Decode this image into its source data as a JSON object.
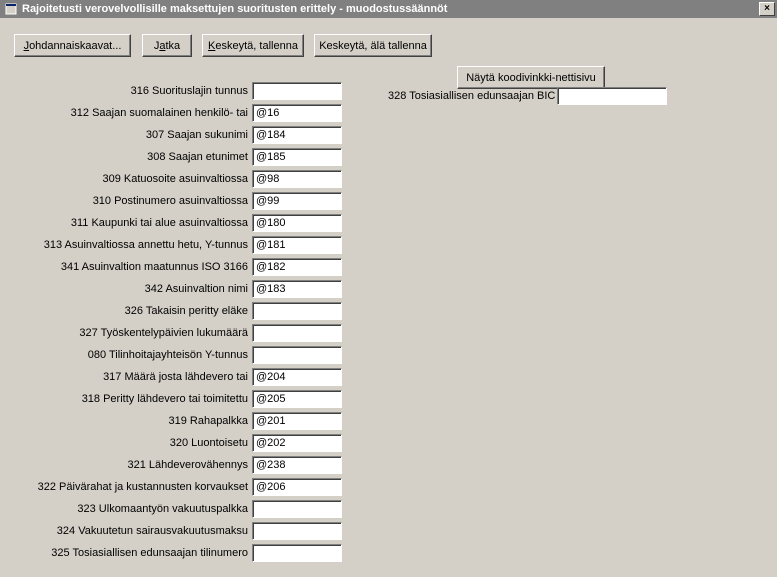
{
  "window": {
    "title": "Rajoitetusti verovelvollisille maksettujen suoritusten erittely - muodostussäännöt",
    "close": "×"
  },
  "toolbar": {
    "johdannaiskaavat": "Johdannaiskaavat...",
    "jatka_pre": "J",
    "jatka_u": "a",
    "jatka_post": "tka",
    "keskeyta_tallenna_u": "K",
    "keskeyta_tallenna_post": "eskeytä, tallenna",
    "keskeyta_ala_tallenna": "Keskeytä, älä tallenna",
    "nayta": "Näytä koodivinkki-nettisivu"
  },
  "fields": [
    {
      "label": "316 Suorituslajin tunnus",
      "value": ""
    },
    {
      "label": "312 Saajan suomalainen henkilö- tai",
      "value": "@16"
    },
    {
      "label": "307 Saajan sukunimi",
      "value": "@184"
    },
    {
      "label": "308 Saajan etunimet",
      "value": "@185"
    },
    {
      "label": "309 Katuosoite asuinvaltiossa",
      "value": "@98"
    },
    {
      "label": "310 Postinumero asuinvaltiossa",
      "value": "@99"
    },
    {
      "label": "311 Kaupunki tai alue asuinvaltiossa",
      "value": "@180"
    },
    {
      "label": "313 Asuinvaltiossa annettu hetu, Y-tunnus",
      "value": "@181"
    },
    {
      "label": "341 Asuinvaltion maatunnus ISO 3166",
      "value": "@182"
    },
    {
      "label": "342 Asuinvaltion nimi",
      "value": "@183"
    },
    {
      "label": "326 Takaisin peritty eläke",
      "value": ""
    },
    {
      "label": "327 Työskentelypäivien lukumäärä",
      "value": ""
    },
    {
      "label": "080 Tilinhoitajayhteisön Y-tunnus",
      "value": ""
    },
    {
      "label": "317 Määrä josta lähdevero tai",
      "value": "@204"
    },
    {
      "label": "318 Peritty lähdevero tai toimitettu",
      "value": "@205"
    },
    {
      "label": "319 Rahapalkka",
      "value": "@201"
    },
    {
      "label": "320 Luontoisetu",
      "value": "@202"
    },
    {
      "label": "321 Lähdeverovähennys",
      "value": "@238"
    },
    {
      "label": "322 Päivärahat ja kustannusten korvaukset",
      "value": "@206"
    },
    {
      "label": "323 Ulkomaantyön vakuutuspalkka",
      "value": ""
    },
    {
      "label": "324 Vakuutetun sairausvakuutusmaksu",
      "value": ""
    },
    {
      "label": "325 Tosiasiallisen edunsaajan tilinumero",
      "value": ""
    }
  ],
  "right": {
    "bic_label": "328 Tosiasiallisen edunsaajan BIC",
    "bic_value": ""
  }
}
